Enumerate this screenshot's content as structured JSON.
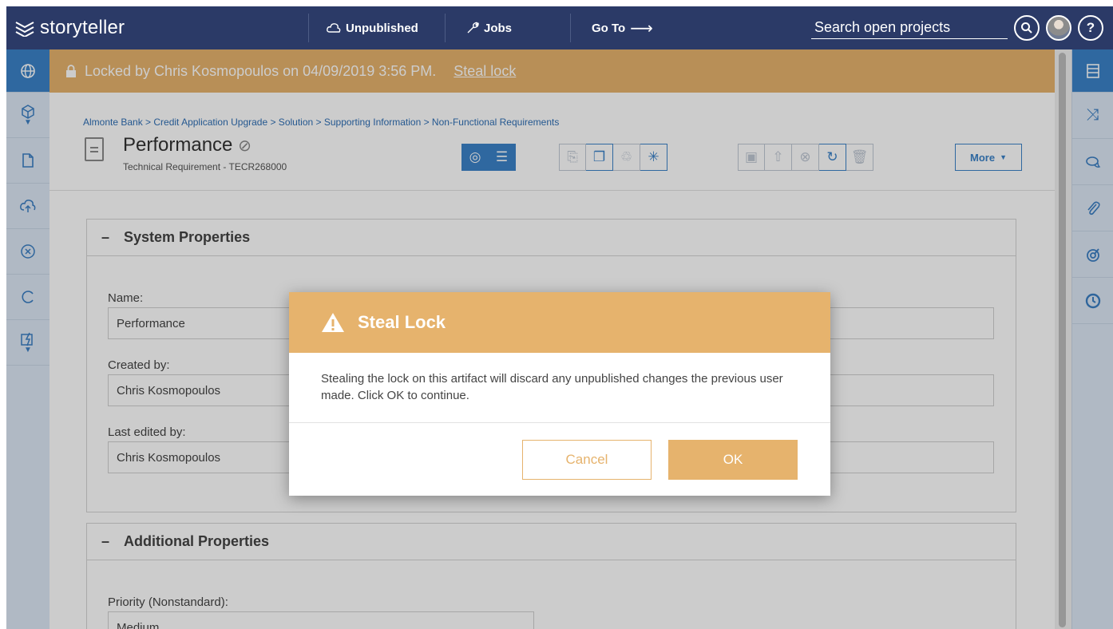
{
  "topbar": {
    "app_name": "storyteller",
    "unpublished_label": "Unpublished",
    "jobs_label": "Jobs",
    "goto_label": "Go To",
    "search_placeholder": "Search open projects",
    "help_label": "?"
  },
  "lock_banner": {
    "message": "Locked by Chris Kosmopoulos on 04/09/2019 3:56 PM.",
    "link": "Steal lock"
  },
  "breadcrumb": "Almonte Bank > Credit Application Upgrade > Solution > Supporting Information > Non-Functional Requirements",
  "artifact": {
    "title": "Performance",
    "subtitle": "Technical Requirement - TECR268000"
  },
  "toolbar": {
    "more_label": "More"
  },
  "system_properties": {
    "heading": "System Properties",
    "collapse": "–",
    "fields": [
      {
        "label": "Name:",
        "value": "Performance"
      },
      {
        "label": "Created by:",
        "value": "Chris Kosmopoulos"
      },
      {
        "label": "Last edited by:",
        "value": "Chris Kosmopoulos"
      }
    ]
  },
  "additional_properties": {
    "heading": "Additional Properties",
    "collapse": "–",
    "fields": [
      {
        "label": "Priority (Nonstandard):",
        "value": "Medium"
      }
    ]
  },
  "modal": {
    "title": "Steal Lock",
    "message": "Stealing the lock on this artifact will discard any unpublished changes the previous user made. Click OK to continue.",
    "cancel_label": "Cancel",
    "ok_label": "OK"
  },
  "colors": {
    "topbar": "#2b3a67",
    "accent": "#3b82c8",
    "warning": "#e6b36d"
  }
}
